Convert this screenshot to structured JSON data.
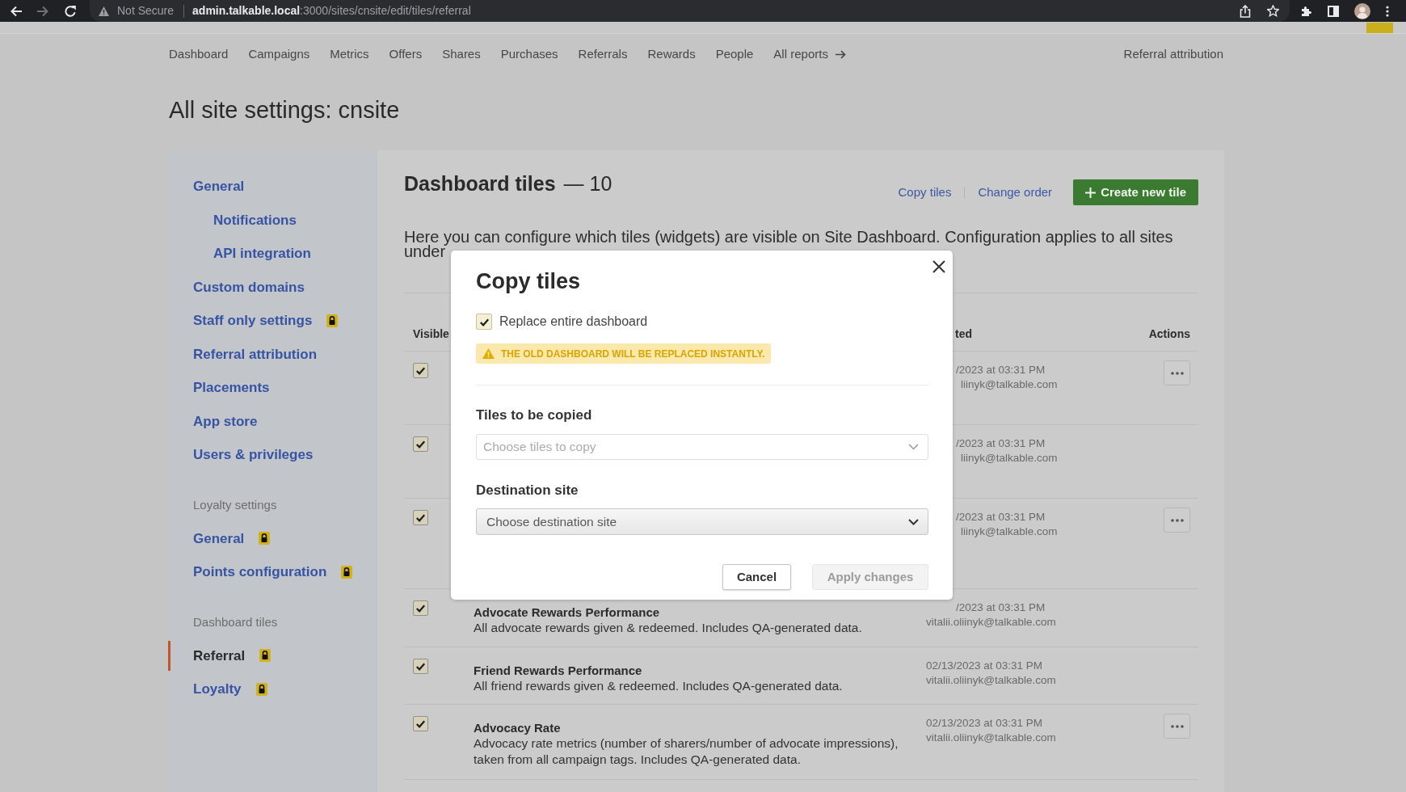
{
  "browser": {
    "security": "Not Secure",
    "url_host": "admin.talkable.local",
    "url_path": ":3000/sites/cnsite/edit/tiles/referral"
  },
  "top_nav": {
    "items": [
      {
        "label": "Dashboard",
        "kind": "link"
      },
      {
        "label": "Campaigns",
        "kind": "link"
      },
      {
        "label": "Metrics",
        "kind": "link"
      },
      {
        "label": "Offers",
        "kind": "link"
      },
      {
        "label": "Shares",
        "kind": "link"
      },
      {
        "label": "Purchases",
        "kind": "link"
      },
      {
        "label": "Referrals",
        "kind": "link"
      },
      {
        "label": "Rewards",
        "kind": "link"
      },
      {
        "label": "People",
        "kind": "link"
      },
      {
        "label": "All reports",
        "kind": "more"
      }
    ],
    "right_link": "Referral attribution"
  },
  "page_title": "All site settings: cnsite",
  "sidebar": {
    "groups": [
      {
        "items": [
          {
            "label": "General",
            "locked": false,
            "selected": false,
            "children": [
              {
                "label": "Notifications",
                "locked": false,
                "selected": false
              },
              {
                "label": "API integration",
                "locked": false,
                "selected": false
              }
            ]
          },
          {
            "label": "Custom domains",
            "locked": false,
            "selected": false
          },
          {
            "label": "Staff only settings",
            "locked": true,
            "selected": false
          },
          {
            "label": "Referral attribution",
            "locked": false,
            "selected": false
          },
          {
            "label": "Placements",
            "locked": false,
            "selected": false
          },
          {
            "label": "App store",
            "locked": false,
            "selected": false
          },
          {
            "label": "Users & privileges",
            "locked": false,
            "selected": false
          }
        ]
      },
      {
        "heading": "Loyalty settings",
        "items": [
          {
            "label": "General",
            "locked": true,
            "selected": false
          },
          {
            "label": "Points configuration",
            "locked": true,
            "selected": false
          }
        ]
      },
      {
        "heading": "Dashboard tiles",
        "items": [
          {
            "label": "Referral",
            "locked": true,
            "selected": true
          },
          {
            "label": "Loyalty",
            "locked": true,
            "selected": false
          }
        ]
      }
    ]
  },
  "main": {
    "title": "Dashboard tiles",
    "count": "— 10",
    "actions": [
      {
        "label": "Copy tiles",
        "kind": "link"
      },
      {
        "label": "Change order",
        "kind": "link"
      },
      {
        "label": "Create new tile",
        "kind": "primary"
      }
    ],
    "description": "Here you can configure which tiles (widgets) are visible on Site Dashboard. Configuration applies to all sites under"
  },
  "table": {
    "columns": [
      {
        "label": "Visible",
        "kind": "check"
      },
      {
        "label": "ted",
        "kind": "date"
      },
      {
        "label": "Actions",
        "kind": "actions"
      }
    ],
    "rows": [
      {
        "visible": true,
        "date": "/2023 at 03:31 PM",
        "author": "liinyk@talkable.com",
        "has_menu": true
      },
      {
        "visible": true,
        "date": "/2023 at 03:31 PM",
        "author": "liinyk@talkable.com",
        "has_menu": false
      },
      {
        "visible": true,
        "date": "/2023 at 03:31 PM",
        "author": "liinyk@talkable.com",
        "has_menu": true
      },
      {
        "visible": true,
        "title": "Advocate Rewards Performance",
        "description": "All advocate rewards given & redeemed. Includes QA-generated data.",
        "date": "/2023 at 03:31 PM",
        "author": "vitalii.oliinyk@talkable.com",
        "has_menu": false
      },
      {
        "visible": true,
        "title": "Friend Rewards Performance",
        "description": "All friend rewards given & redeemed. Includes QA-generated data.",
        "date": "02/13/2023 at 03:31 PM",
        "author": "vitalii.oliinyk@talkable.com",
        "has_menu": false
      },
      {
        "visible": true,
        "title": "Advocacy Rate",
        "description": "Advocacy rate metrics (number of sharers/number of advocate impressions), taken from all campaign tags. Includes QA-generated data.",
        "date": "02/13/2023 at 03:31 PM",
        "author": "vitalii.oliinyk@talkable.com",
        "has_menu": true
      }
    ]
  },
  "modal": {
    "title": "Copy tiles",
    "replace_option": {
      "label": "Replace entire dashboard",
      "checked": true
    },
    "warning": "THE OLD DASHBOARD WILL BE REPLACED INSTANTLY.",
    "fields": [
      {
        "label": "Tiles to be copied",
        "kind": "multiselect",
        "placeholder": "Choose tiles to copy"
      },
      {
        "label": "Destination site",
        "kind": "select",
        "value": "Choose destination site"
      }
    ],
    "buttons": [
      {
        "label": "Cancel",
        "disabled": false
      },
      {
        "label": "Apply changes",
        "disabled": true
      }
    ]
  }
}
